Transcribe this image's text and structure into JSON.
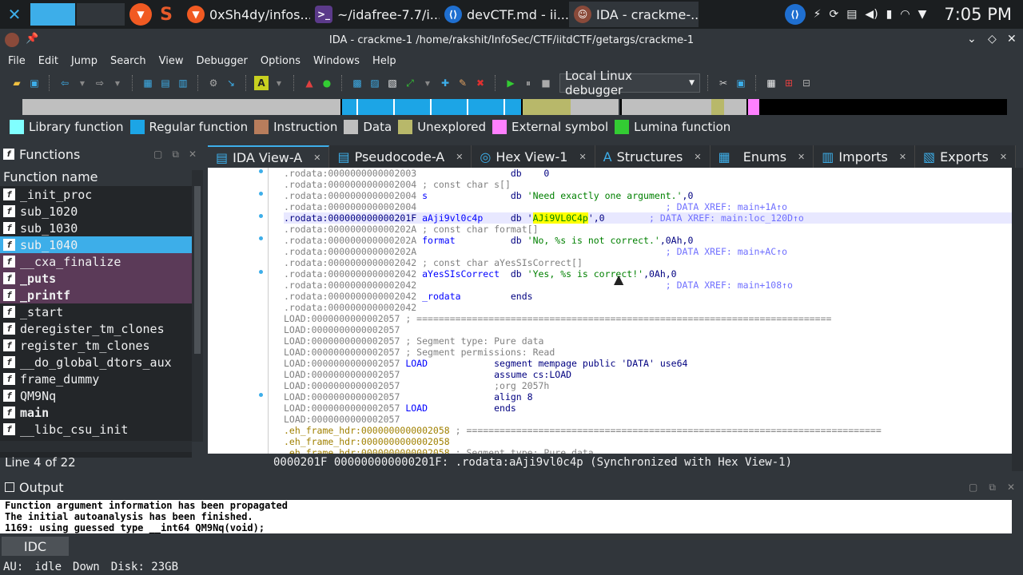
{
  "taskbar": {
    "apps": [
      {
        "label": "0xSh4dy/infos...",
        "icon": "brave-icon"
      },
      {
        "label": "~/idafree-7.7/i...",
        "icon": "terminal-icon"
      },
      {
        "label": "devCTF.md - ii...",
        "icon": "vscode-icon"
      },
      {
        "label": "IDA - crackme-...",
        "icon": "ida-icon"
      }
    ],
    "clock": "7:05 PM"
  },
  "window": {
    "title": "IDA - crackme-1 /home/rakshit/InfoSec/CTF/iitdCTF/getargs/crackme-1"
  },
  "menu": [
    "File",
    "Edit",
    "Jump",
    "Search",
    "View",
    "Debugger",
    "Options",
    "Windows",
    "Help"
  ],
  "debugger_select": "Local Linux debugger",
  "legend": [
    {
      "label": "Library function",
      "color": "#80ffff"
    },
    {
      "label": "Regular function",
      "color": "#1ca5e6"
    },
    {
      "label": "Instruction",
      "color": "#b87d5c"
    },
    {
      "label": "Data",
      "color": "#bfbfbf"
    },
    {
      "label": "Unexplored",
      "color": "#b8b86a"
    },
    {
      "label": "External symbol",
      "color": "#ff80ff"
    },
    {
      "label": "Lumina function",
      "color": "#33cc33"
    }
  ],
  "functions": {
    "title": "Functions",
    "column": "Function name",
    "items": [
      {
        "name": "_init_proc",
        "style": ""
      },
      {
        "name": "sub_1020",
        "style": ""
      },
      {
        "name": "sub_1030",
        "style": ""
      },
      {
        "name": "sub_1040",
        "style": "sel"
      },
      {
        "name": "__cxa_finalize",
        "style": "imp"
      },
      {
        "name": "_puts",
        "style": "imp bold"
      },
      {
        "name": "_printf",
        "style": "imp bold"
      },
      {
        "name": "_start",
        "style": ""
      },
      {
        "name": "deregister_tm_clones",
        "style": ""
      },
      {
        "name": "register_tm_clones",
        "style": ""
      },
      {
        "name": "__do_global_dtors_aux",
        "style": ""
      },
      {
        "name": "frame_dummy",
        "style": ""
      },
      {
        "name": "QM9Nq",
        "style": ""
      },
      {
        "name": "main",
        "style": "bold"
      },
      {
        "name": "__libc_csu_init",
        "style": ""
      }
    ],
    "status": "Line 4 of 22"
  },
  "tabs": [
    {
      "label": "IDA View-A",
      "icon": "ida-view-icon",
      "active": true
    },
    {
      "label": "Pseudocode-A",
      "icon": "pseudocode-icon"
    },
    {
      "label": "Hex View-1",
      "icon": "hex-view-icon"
    },
    {
      "label": "Structures",
      "icon": "structures-icon"
    },
    {
      "label": "Enums",
      "icon": "enums-icon"
    },
    {
      "label": "Imports",
      "icon": "imports-icon"
    },
    {
      "label": "Exports",
      "icon": "exports-icon"
    }
  ],
  "code": {
    "l1_seg": ".rodata:0000000000002003",
    "l1_rest": "                 db    0",
    "l2_seg": ".rodata:0000000000002004",
    "l2_rest": " ; const char s[]",
    "l3_seg": ".rodata:0000000000002004",
    "l3_name": " s",
    "l3_op": "               db ",
    "l3_str": "'Need exactly one argument.'",
    "l3_tail": ",0",
    "l4_seg": ".rodata:0000000000002004",
    "l4_xr": "                                             ; DATA XREF: main+1A↑o",
    "l5_seg": ".rodata:000000000000201F",
    "l5_name": " aAji9vl0c4p",
    "l5_op": "     db '",
    "l5_hl": "AJi9VL0C4p",
    "l5_tail": "',0",
    "l5_xr": "        ; DATA XREF: main:loc_120D↑o",
    "l6_seg": ".rodata:000000000000202A",
    "l6_rest": " ; const char format[]",
    "l7_seg": ".rodata:000000000000202A",
    "l7_name": " format",
    "l7_op": "          db ",
    "l7_str": "'No, %s is not correct.'",
    "l7_tail": ",0Ah,0",
    "l8_seg": ".rodata:000000000000202A",
    "l8_xr": "                                             ; DATA XREF: main+AC↑o",
    "l9_seg": ".rodata:0000000000002042",
    "l9_rest": " ; const char aYesSIsCorrect[]",
    "l10_seg": ".rodata:0000000000002042",
    "l10_name": " aYesSIsCorrect",
    "l10_op": "  db ",
    "l10_str": "'Yes, %s is correct!'",
    "l10_tail": ",0Ah,0",
    "l11_seg": ".rodata:0000000000002042",
    "l11_xr": "                                             ; DATA XREF: main+108↑o",
    "l12_seg": ".rodata:0000000000002042",
    "l12_name": " _rodata",
    "l12_op": "         ends",
    "l13_seg": ".rodata:0000000000002042",
    "l13_rest": "",
    "l14_seg": "LOAD:0000000000002057",
    "l14_rest": " ; ===========================================================================",
    "l15_seg": "LOAD:0000000000002057",
    "l15_rest": "",
    "l16_seg": "LOAD:0000000000002057",
    "l16_rest": " ; Segment type: Pure data",
    "l17_seg": "LOAD:0000000000002057",
    "l17_rest": " ; Segment permissions: Read",
    "l18_seg": "LOAD:0000000000002057",
    "l18_name": " LOAD",
    "l18_op": "            segment mempage public 'DATA' use64",
    "l19_seg": "LOAD:0000000000002057",
    "l19_op": "                 assume cs:LOAD",
    "l20_seg": "LOAD:0000000000002057",
    "l20_rest": "                 ;org 2057h",
    "l21_seg": "LOAD:0000000000002057",
    "l21_op": "                 align 8",
    "l22_seg": "LOAD:0000000000002057",
    "l22_name": " LOAD",
    "l22_op": "            ends",
    "l23_seg": "LOAD:0000000000002057",
    "l23_rest": "",
    "l24_seg": ".eh_frame_hdr:0000000000002058",
    "l24_rest": " ; ===========================================================================",
    "l25_seg": ".eh_frame_hdr:0000000000002058",
    "l25_rest": "",
    "l26_seg": ".eh_frame_hdr:0000000000002058",
    "l26_rest": " ; Segment type: Pure data"
  },
  "sync_status": "0000201F 000000000000201F: .rodata:aAji9vl0c4p (Synchronized with Hex View-1)",
  "output": {
    "title": "Output",
    "lines": [
      "Function argument information has been propagated",
      "The initial autoanalysis has been finished.",
      "1169: using guessed type __int64 QM9Nq(void);"
    ]
  },
  "idc_label": "IDC",
  "status": {
    "au": "AU:",
    "state": "idle",
    "dir": "Down",
    "disk": "Disk: 23GB"
  }
}
